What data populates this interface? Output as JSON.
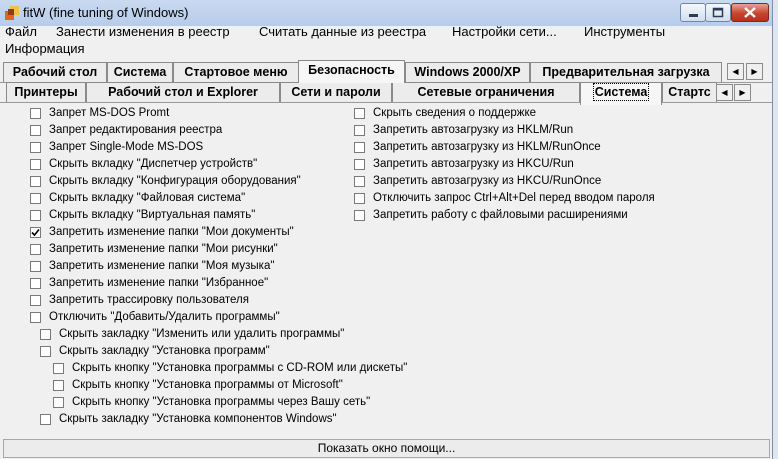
{
  "window": {
    "title": "fitW (fine tuning of Windows)"
  },
  "menu": [
    "Файл",
    "Занести изменения в реестр",
    "Считать данные из реестра",
    "Настройки сети...",
    "Инструменты",
    "Информация"
  ],
  "tabs_top": [
    "Рабочий стол",
    "Система",
    "Стартовое меню",
    "Безопасность",
    "Windows 2000/XP",
    "Предварительная загрузка"
  ],
  "tabs_sub": [
    "Принтеры",
    "Рабочий стол и Explorer",
    "Сети и пароли",
    "Сетевые ограничения",
    "Система",
    "Стартс"
  ],
  "options_left": [
    {
      "label": "Запрет MS-DOS Promt",
      "checked": false
    },
    {
      "label": "Запрет редактирования реестра",
      "checked": false
    },
    {
      "label": "Запрет Single-Mode MS-DOS",
      "checked": false
    },
    {
      "label": "Скрыть вкладку \"Диспетчер устройств\"",
      "checked": false
    },
    {
      "label": "Скрыть вкладку \"Конфигурация оборудования\"",
      "checked": false
    },
    {
      "label": "Скрыть вкладку \"Файловая система\"",
      "checked": false
    },
    {
      "label": "Скрыть вкладку \"Виртуальная память\"",
      "checked": false
    },
    {
      "label": "Запретить изменение папки \"Мои документы\"",
      "checked": true
    },
    {
      "label": "Запретить изменение папки \"Мои рисунки\"",
      "checked": false
    },
    {
      "label": "Запретить изменение папки \"Моя музыка\"",
      "checked": false
    },
    {
      "label": "Запретить изменение папки \"Избранное\"",
      "checked": false
    },
    {
      "label": "Запретить трассировку пользователя",
      "checked": false
    },
    {
      "label": "Отключить \"Добавить/Удалить программы\"",
      "checked": false
    }
  ],
  "options_nested": [
    {
      "label": "Скрыть закладку \"Изменить или удалить программы\"",
      "checked": false
    },
    {
      "label": "Скрыть закладку \"Установка программ\"",
      "checked": false
    },
    {
      "label": "Скрыть кнопку \"Установка программы с CD-ROM или дискеты\"",
      "checked": false
    },
    {
      "label": "Скрыть кнопку \"Установка программы от Microsoft\"",
      "checked": false
    },
    {
      "label": "Скрыть кнопку \"Установка программы через Вашу сеть\"",
      "checked": false
    },
    {
      "label": "Скрыть закладку \"Установка компонентов Windows\"",
      "checked": false
    }
  ],
  "options_right": [
    {
      "label": "Скрыть сведения о поддержке",
      "checked": false
    },
    {
      "label": "Запретить автозагрузку из HKLM/Run",
      "checked": false
    },
    {
      "label": "Запретить автозагрузку из HKLM/RunOnce",
      "checked": false
    },
    {
      "label": "Запретить автозагрузку из HKCU/Run",
      "checked": false
    },
    {
      "label": "Запретить автозагрузку из HKCU/RunOnce",
      "checked": false
    },
    {
      "label": "Отключить запрос Ctrl+Alt+Del перед вводом пароля",
      "checked": false
    },
    {
      "label": "Запретить работу с файловыми расширениями",
      "checked": false
    }
  ],
  "status": {
    "help_button": "Показать окно помощи..."
  }
}
